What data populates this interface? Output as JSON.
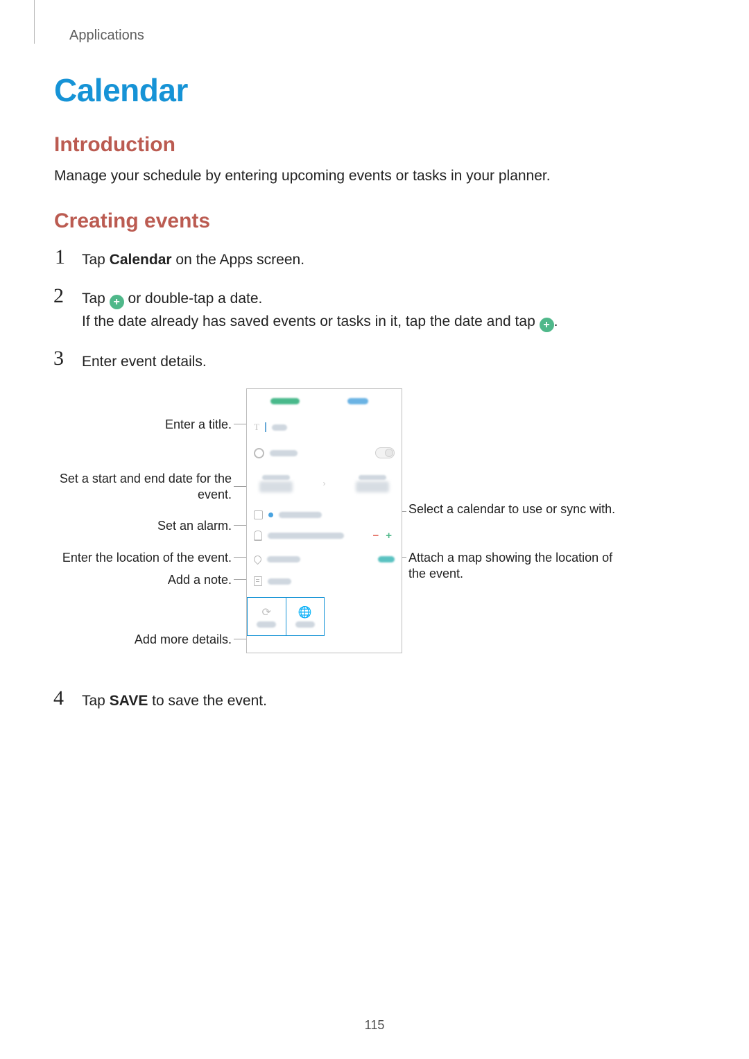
{
  "header": {
    "breadcrumb": "Applications"
  },
  "title": "Calendar",
  "sections": {
    "intro": {
      "heading": "Introduction",
      "body": "Manage your schedule by entering upcoming events or tasks in your planner."
    },
    "create": {
      "heading": "Creating events",
      "steps": {
        "s1": {
          "num": "1",
          "pre": "Tap ",
          "bold": "Calendar",
          "post": " on the Apps screen."
        },
        "s2": {
          "num": "2",
          "line1_pre": "Tap ",
          "line1_post": " or double-tap a date.",
          "line2_pre": "If the date already has saved events or tasks in it, tap the date and tap ",
          "line2_post": "."
        },
        "s3": {
          "num": "3",
          "text": "Enter event details."
        },
        "s4": {
          "num": "4",
          "pre": "Tap ",
          "bold": "SAVE",
          "post": " to save the event."
        }
      }
    }
  },
  "callouts": {
    "title": "Enter a title.",
    "dates": "Set a start and end date for the event.",
    "alarm": "Set an alarm.",
    "location": "Enter the location of the event.",
    "note": "Add a note.",
    "more": "Add more details.",
    "calendar": "Select a calendar to use or sync with.",
    "map": "Attach a map showing the location of the event."
  },
  "icons": {
    "plus": "+"
  },
  "page_number": "115"
}
